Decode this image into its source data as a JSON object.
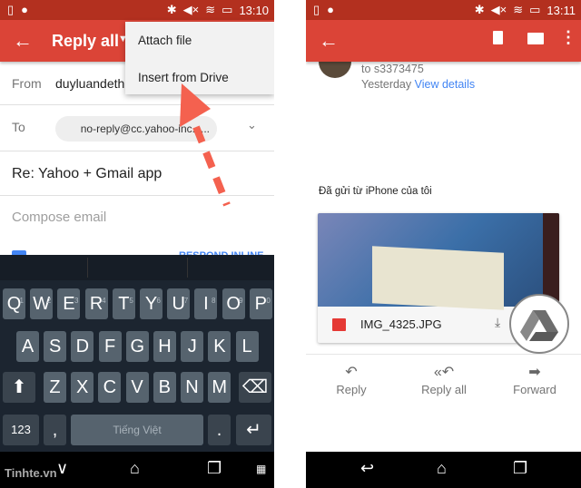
{
  "left": {
    "status": {
      "time": "13:10"
    },
    "appbar": {
      "title": "Reply all"
    },
    "menu": {
      "items": [
        "Attach file",
        "Insert from Drive"
      ]
    },
    "from": {
      "label": "From",
      "value": "duyluandethu"
    },
    "to": {
      "label": "To",
      "chip": "no-reply@cc.yahoo-inc.c..."
    },
    "subject": "Re: Yahoo + Gmail app",
    "compose_placeholder": "Compose email",
    "respond_inline": "RESPOND INLINE",
    "keyboard": {
      "row1": [
        "Q",
        "W",
        "E",
        "R",
        "T",
        "Y",
        "U",
        "I",
        "O",
        "P"
      ],
      "row1_hints": [
        "1",
        "2",
        "3",
        "4",
        "5",
        "6",
        "7",
        "8",
        "9",
        "0"
      ],
      "row2": [
        "A",
        "S",
        "D",
        "F",
        "G",
        "H",
        "J",
        "K",
        "L"
      ],
      "row3": [
        "Z",
        "X",
        "C",
        "V",
        "B",
        "N",
        "M"
      ],
      "num_key": "123",
      "comma": ",",
      "space": "Tiếng Việt",
      "period": "."
    },
    "watermark": "Tinhte.vn"
  },
  "right": {
    "status": {
      "time": "13:11"
    },
    "message": {
      "to": "to s3373475",
      "date": "Yesterday",
      "view_details": "View details",
      "body": "Đã gửi từ iPhone của tôi"
    },
    "attachment": {
      "filename": "IMG_4325.JPG"
    },
    "actions": [
      "Reply",
      "Reply all",
      "Forward"
    ]
  },
  "colors": {
    "appbar": "#db4437",
    "status": "#b3301f",
    "link": "#4285f4",
    "arrow": "#f4614f"
  }
}
